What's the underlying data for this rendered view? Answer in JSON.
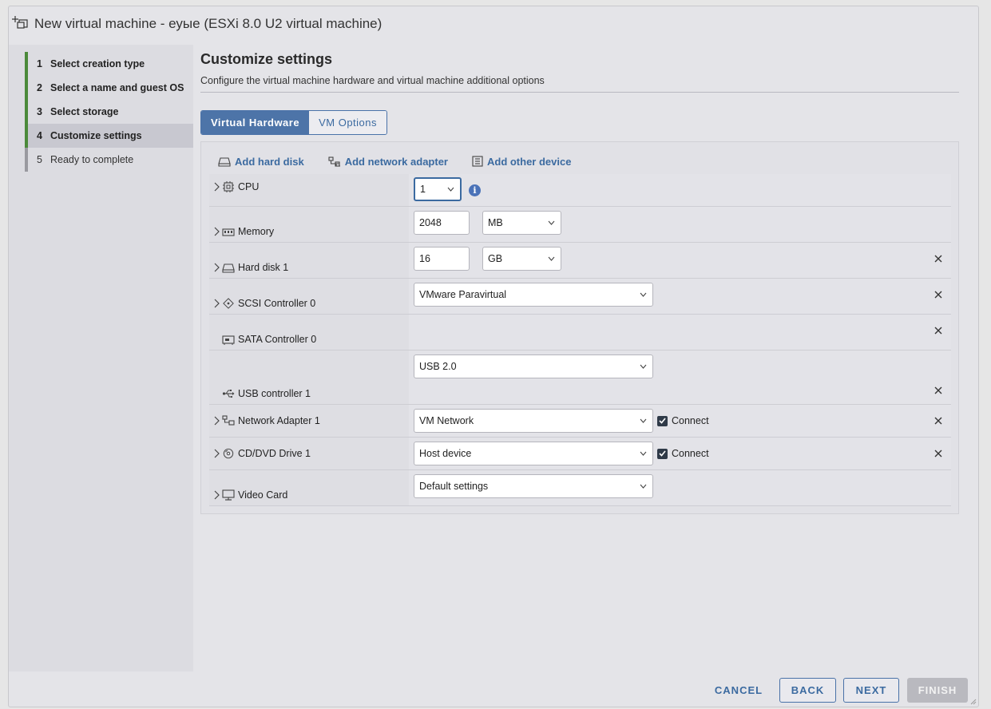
{
  "window": {
    "title": "New virtual machine - еуые (ESXi 8.0 U2 virtual machine)"
  },
  "wizard": {
    "steps": [
      {
        "num": "1",
        "label": "Select creation type",
        "state": "done"
      },
      {
        "num": "2",
        "label": "Select a name and guest OS",
        "state": "done"
      },
      {
        "num": "3",
        "label": "Select storage",
        "state": "done"
      },
      {
        "num": "4",
        "label": "Customize settings",
        "state": "active"
      },
      {
        "num": "5",
        "label": "Ready to complete",
        "state": "pending"
      }
    ]
  },
  "main": {
    "heading": "Customize settings",
    "subheading": "Configure the virtual machine hardware and virtual machine additional options",
    "tabs": [
      {
        "label": "Virtual Hardware",
        "active": true
      },
      {
        "label": "VM Options",
        "active": false
      }
    ]
  },
  "toolbar": {
    "add_hard_disk": "Add hard disk",
    "add_network_adapter": "Add network adapter",
    "add_other_device": "Add other device"
  },
  "hardware": {
    "cpu": {
      "label": "CPU",
      "value": "1"
    },
    "memory": {
      "label": "Memory",
      "value": "2048",
      "unit": "MB"
    },
    "hard_disk": {
      "label": "Hard disk 1",
      "value": "16",
      "unit": "GB"
    },
    "scsi": {
      "label": "SCSI Controller 0",
      "value": "VMware Paravirtual"
    },
    "sata": {
      "label": "SATA Controller 0"
    },
    "usb": {
      "label": "USB controller 1",
      "value": "USB 2.0"
    },
    "network": {
      "label": "Network Adapter 1",
      "value": "VM Network",
      "connect_label": "Connect",
      "connected": true
    },
    "cdrom": {
      "label": "CD/DVD Drive 1",
      "value": "Host device",
      "connect_label": "Connect",
      "connected": true
    },
    "video": {
      "label": "Video Card",
      "value": "Default settings"
    }
  },
  "footer": {
    "cancel": "CANCEL",
    "back": "BACK",
    "next": "NEXT",
    "finish": "FINISH"
  },
  "colors": {
    "accent": "#3b6aa0",
    "step_done": "#4b8a3a",
    "active_tab": "#4d74a8"
  }
}
